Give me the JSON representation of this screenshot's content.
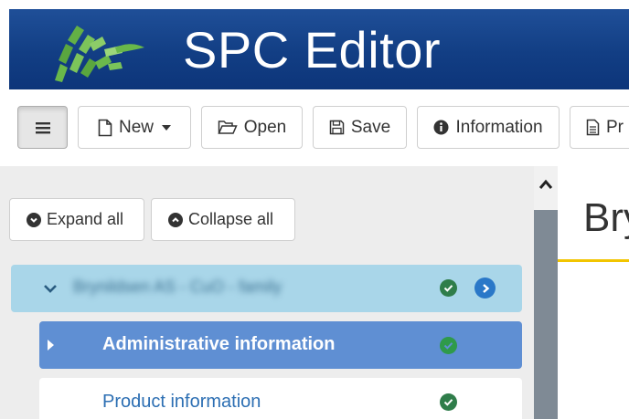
{
  "header": {
    "title": "SPC Editor",
    "logo_icon": "green-leaf-logo-icon",
    "colors": {
      "header_bg": "#123e84",
      "logo": "#69b84a"
    }
  },
  "toolbar": {
    "menu_icon": "hamburger-icon",
    "new_label": "New",
    "open_label": "Open",
    "save_label": "Save",
    "info_label": "Information",
    "print_label": "Pr"
  },
  "sidebar": {
    "expand_all_label": "Expand all",
    "collapse_all_label": "Collapse all",
    "tree": {
      "root_label": "Brynildsen AS - CuO - family",
      "items": [
        {
          "label": "Administrative information",
          "state": "active",
          "status": "ok"
        },
        {
          "label": "Product information",
          "state": "default",
          "status": "ok"
        }
      ]
    }
  },
  "content": {
    "title": "Bry",
    "accent_color": "#f2c500"
  }
}
